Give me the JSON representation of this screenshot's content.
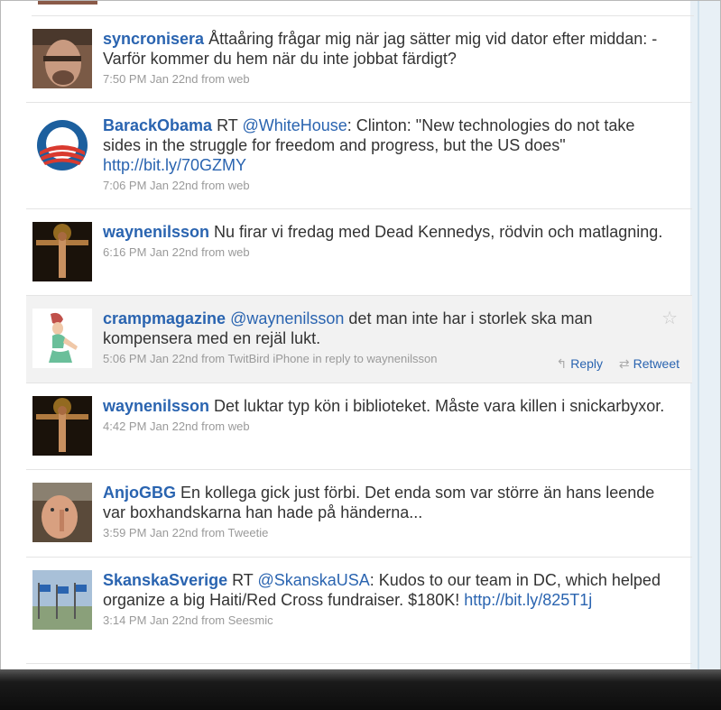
{
  "tweets": [
    {
      "user": "syncronisera",
      "text": " Åttaåring frågar mig när jag sätter mig vid dator efter middan: - Varför kommer du hem när du inte jobbat färdigt?",
      "meta": "7:50 PM Jan 22nd from web"
    },
    {
      "user": "BarackObama",
      "text_prefix": " RT ",
      "mention": "@WhiteHouse",
      "text": ": Clinton: \"New technologies do not take sides in the struggle for freedom and progress, but the US does\" ",
      "link": "http://bit.ly/70GZMY",
      "meta": "7:06 PM Jan 22nd from web"
    },
    {
      "user": "waynenilsson",
      "text": " Nu firar vi fredag med Dead Kennedys, rödvin och matlagning.",
      "meta": "6:16 PM Jan 22nd from web"
    },
    {
      "user": "crampmagazine",
      "mention": "@waynenilsson",
      "text": " det man inte har i storlek ska man kompensera med en rejäl lukt.",
      "meta": "5:06 PM Jan 22nd from TwitBird iPhone in reply to waynenilsson",
      "reply_label": "Reply",
      "retweet_label": "Retweet"
    },
    {
      "user": "waynenilsson",
      "text": " Det luktar typ kön i biblioteket. Måste vara killen i snickarbyxor.",
      "meta": "4:42 PM Jan 22nd from web"
    },
    {
      "user": "AnjoGBG",
      "text": " En kollega gick just förbi. Det enda som var större än hans leende var boxhandskarna han hade på händerna...",
      "meta": "3:59 PM Jan 22nd from Tweetie"
    },
    {
      "user": "SkanskaSverige",
      "text_prefix": " RT ",
      "mention": "@SkanskaUSA",
      "text": ": Kudos to our team in DC, which helped organize a big Haiti/Red Cross fundraiser. $180K! ",
      "link": "http://bit.ly/825T1j",
      "meta": "3:14 PM Jan 22nd from Seesmic"
    }
  ],
  "icons": {
    "star": "star-icon",
    "reply": "reply-arrow-icon",
    "retweet": "retweet-icon"
  },
  "colors": {
    "link": "#2a64b0",
    "text": "#333333",
    "meta": "#9a9a9a",
    "highlight_bg": "#f2f2f2"
  }
}
